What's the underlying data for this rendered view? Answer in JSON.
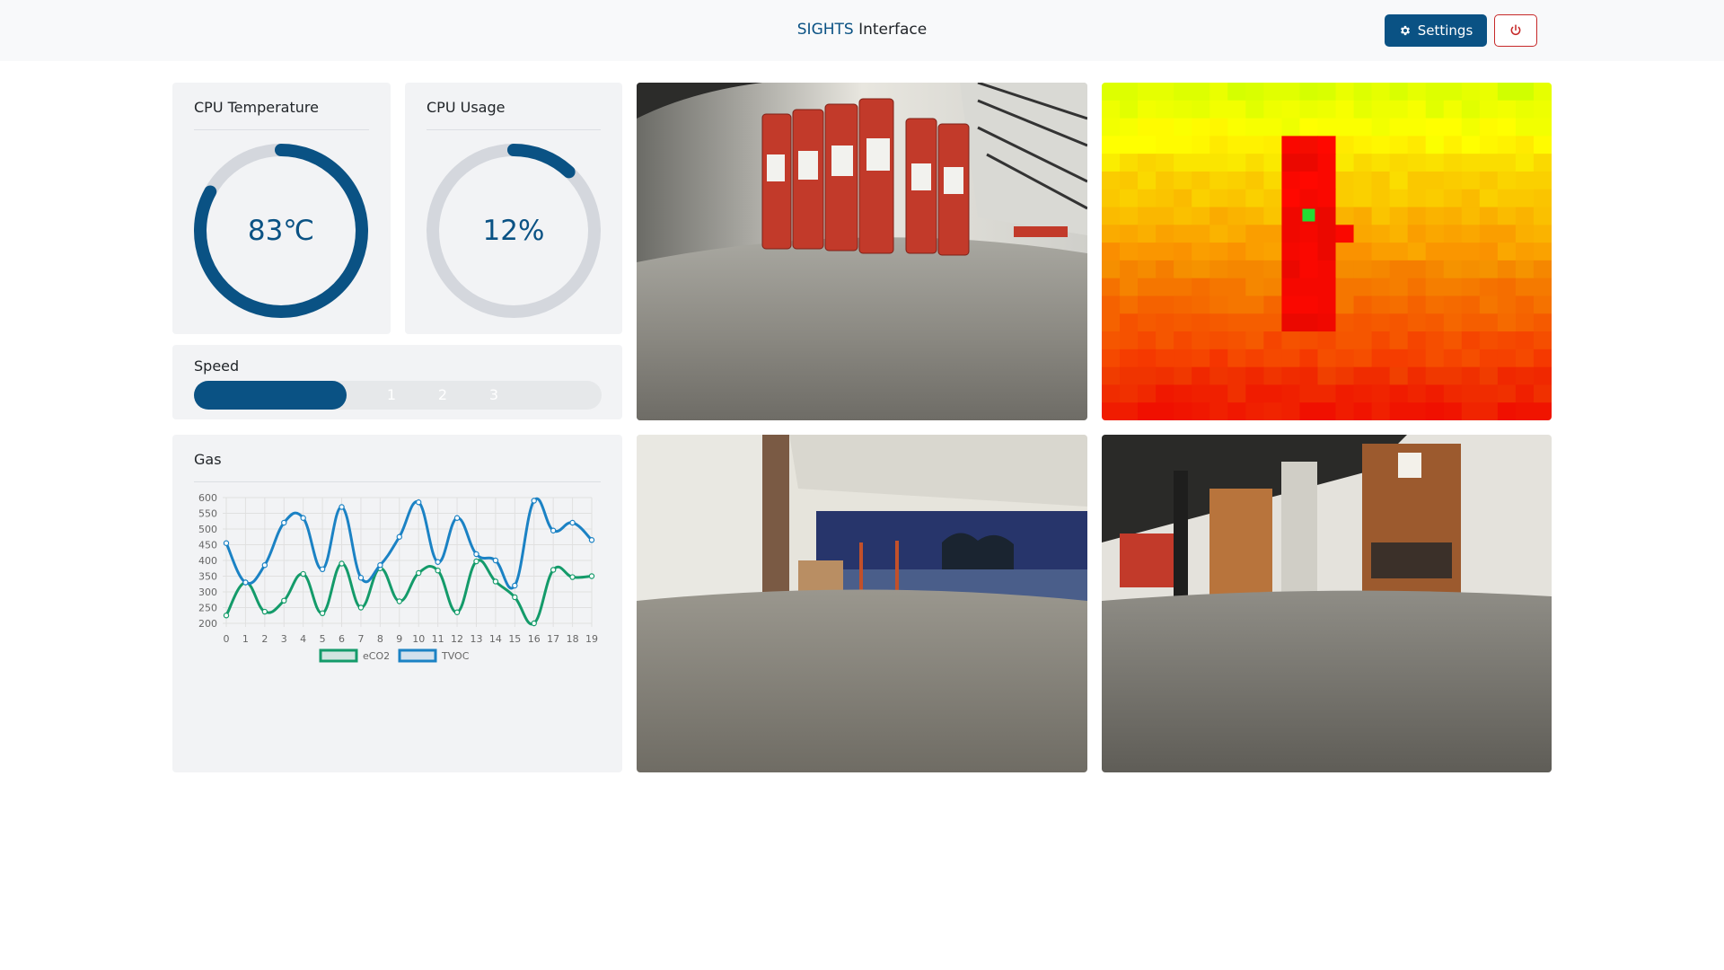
{
  "header": {
    "brand_highlight": "SIGHTS",
    "brand_rest": " Interface",
    "settings_label": "Settings",
    "accent_color": "#0a5284",
    "power_color": "#c62828"
  },
  "cpu_temperature": {
    "title": "CPU Temperature",
    "value_text": "83℃",
    "fraction": 0.83
  },
  "cpu_usage": {
    "title": "CPU Usage",
    "value_text": "12%",
    "fraction": 0.12
  },
  "speed": {
    "title": "Speed",
    "levels": [
      "1",
      "2",
      "3"
    ],
    "selected": 3
  },
  "gas": {
    "title": "Gas",
    "chart_data": {
      "type": "line",
      "x": [
        0,
        1,
        2,
        3,
        4,
        5,
        6,
        7,
        8,
        9,
        10,
        11,
        12,
        13,
        14,
        15,
        16,
        17,
        18,
        19
      ],
      "series": [
        {
          "name": "eCO2",
          "color": "#149b6a",
          "values": [
            225,
            330,
            237,
            272,
            357,
            232,
            390,
            250,
            375,
            270,
            360,
            368,
            235,
            397,
            333,
            283,
            200,
            370,
            347,
            350
          ]
        },
        {
          "name": "TVOC",
          "color": "#1b82c4",
          "values": [
            455,
            330,
            385,
            520,
            535,
            372,
            570,
            345,
            385,
            475,
            585,
            395,
            535,
            420,
            400,
            320,
            590,
            495,
            520,
            465
          ]
        }
      ],
      "ylim": [
        200,
        600
      ],
      "yticks": [
        600,
        550,
        500,
        450,
        400,
        350,
        300,
        250,
        200
      ],
      "grid": true,
      "legend": "bottom"
    }
  },
  "cameras": [
    {
      "name": "camera-front"
    },
    {
      "name": "camera-thermal"
    },
    {
      "name": "camera-left"
    },
    {
      "name": "camera-right"
    }
  ]
}
